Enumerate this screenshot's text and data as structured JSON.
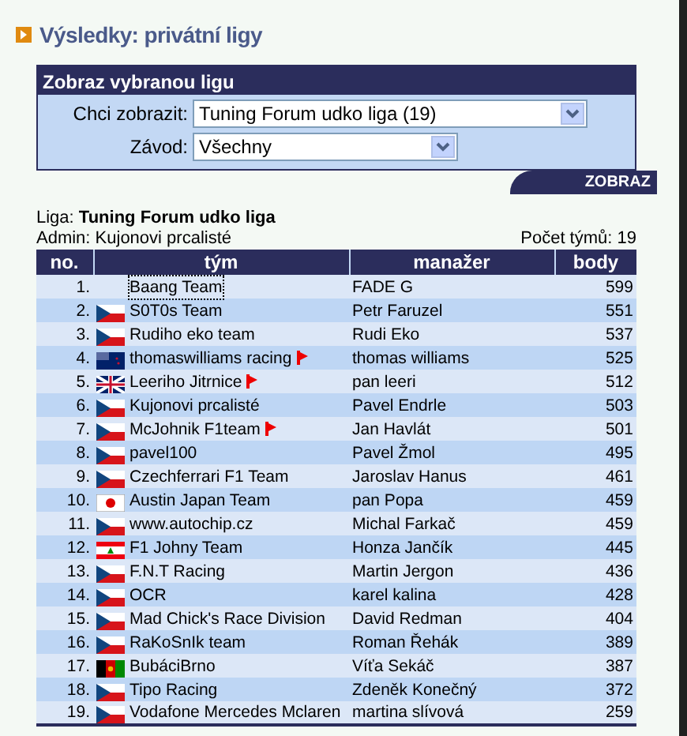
{
  "title": "Výsledky: privátní ligy",
  "filter": {
    "heading": "Zobraz vybranou ligu",
    "fields": [
      {
        "label": "Chci zobrazit:",
        "value": "Tuning Forum udko liga  (19)"
      },
      {
        "label": "Závod:",
        "value": "Všechny"
      }
    ],
    "button": "ZOBRAZ"
  },
  "league": {
    "label": "Liga:",
    "name": "Tuning Forum udko liga",
    "admin": "Admin: Kujonovi prcalisté",
    "count": "Počet týmů: 19"
  },
  "table": {
    "columns": [
      "no.",
      "tým",
      "manažer",
      "body"
    ],
    "rows": [
      {
        "no": "1.",
        "team": "Baang Team",
        "marked": false,
        "selected": true,
        "manager": "FADE G",
        "points": "599"
      },
      {
        "no": "2.",
        "kind": "cz",
        "team": "S0T0s Team",
        "marked": false,
        "selected": false,
        "manager": "Petr Faruzel",
        "points": "551"
      },
      {
        "no": "3.",
        "kind": "cz",
        "team": "Rudiho eko team",
        "marked": false,
        "selected": false,
        "manager": "Rudi Eko",
        "points": "537"
      },
      {
        "no": "4.",
        "kind": "nz",
        "team": "thomaswilliams racing",
        "marked": true,
        "selected": false,
        "manager": "thomas williams",
        "points": "525"
      },
      {
        "no": "5.",
        "kind": "gb",
        "team": "Leeriho Jitrnice",
        "marked": true,
        "selected": false,
        "manager": "pan leeri",
        "points": "512"
      },
      {
        "no": "6.",
        "kind": "cz",
        "team": "Kujonovi prcalisté",
        "marked": false,
        "selected": false,
        "manager": "Pavel Endrle",
        "points": "503"
      },
      {
        "no": "7.",
        "kind": "cz",
        "team": "McJohnik F1team",
        "marked": true,
        "selected": false,
        "manager": "Jan Havlát",
        "points": "501"
      },
      {
        "no": "8.",
        "kind": "cz",
        "team": "pavel100",
        "marked": false,
        "selected": false,
        "manager": "Pavel Žmol",
        "points": "495"
      },
      {
        "no": "9.",
        "kind": "cz",
        "team": "Czechferrari F1 Team",
        "marked": false,
        "selected": false,
        "manager": "Jaroslav Hanus",
        "points": "461"
      },
      {
        "no": "10.",
        "kind": "jp",
        "team": "Austin Japan Team",
        "marked": false,
        "selected": false,
        "manager": "pan Popa",
        "points": "459"
      },
      {
        "no": "11.",
        "kind": "cz",
        "team": "www.autochip.cz",
        "marked": false,
        "selected": false,
        "manager": "Michal Farkač",
        "points": "459"
      },
      {
        "no": "12.",
        "kind": "lb",
        "team": "F1 Johny Team",
        "marked": false,
        "selected": false,
        "manager": "Honza Jančík",
        "points": "445"
      },
      {
        "no": "13.",
        "kind": "cz",
        "team": "F.N.T Racing",
        "marked": false,
        "selected": false,
        "manager": "Martin Jergon",
        "points": "436"
      },
      {
        "no": "14.",
        "kind": "cz",
        "team": "OCR",
        "marked": false,
        "selected": false,
        "manager": "karel kalina",
        "points": "428"
      },
      {
        "no": "15.",
        "kind": "cz",
        "team": "Mad Chick's Race Division",
        "marked": false,
        "selected": false,
        "manager": "David Redman",
        "points": "404"
      },
      {
        "no": "16.",
        "kind": "cz",
        "team": "RaKoSnIk team",
        "marked": false,
        "selected": false,
        "manager": "Roman Řehák",
        "points": "389"
      },
      {
        "no": "17.",
        "kind": "af",
        "team": "BubáciBrno",
        "marked": false,
        "selected": false,
        "manager": "Víťa Sekáč",
        "points": "387"
      },
      {
        "no": "18.",
        "kind": "cz",
        "team": "Tipo Racing",
        "marked": false,
        "selected": false,
        "manager": "Zdeněk Konečný",
        "points": "372"
      },
      {
        "no": "19.",
        "kind": "cz",
        "team": "Vodafone Mercedes Mclaren",
        "marked": false,
        "selected": false,
        "manager": "martina slívová",
        "points": "259"
      }
    ]
  }
}
